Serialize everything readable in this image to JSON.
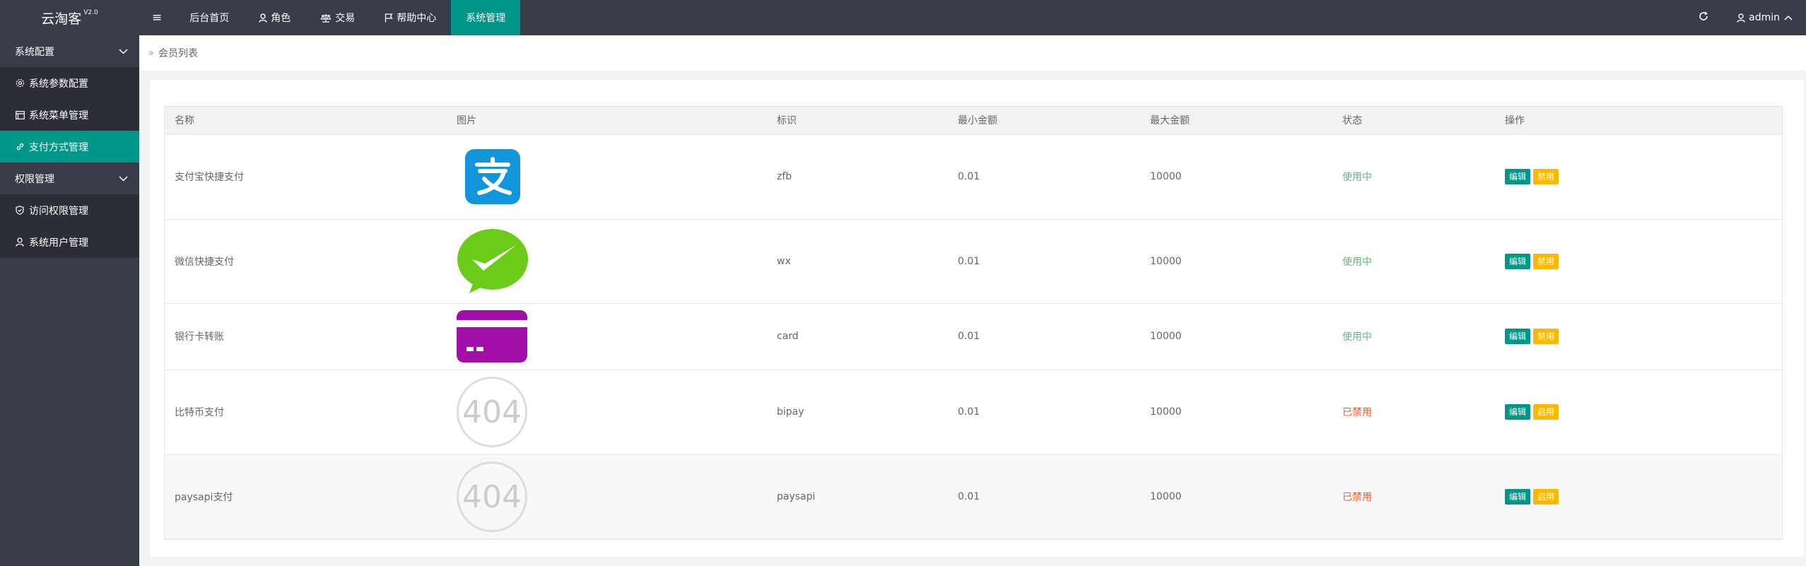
{
  "app": {
    "title": "云淘客",
    "version": "V2.0"
  },
  "nav": {
    "toggle_icon": "menu-icon",
    "items": [
      {
        "label": "后台首页",
        "icon": ""
      },
      {
        "label": "角色",
        "icon": "user-icon"
      },
      {
        "label": "交易",
        "icon": "scale-icon"
      },
      {
        "label": "帮助中心",
        "icon": "flag-icon"
      },
      {
        "label": "系统管理",
        "icon": "",
        "active": true
      }
    ]
  },
  "header_right": {
    "refresh_icon": "refresh-icon",
    "user": "admin"
  },
  "sidebar": {
    "groups": [
      {
        "label": "系统配置",
        "items": [
          {
            "label": "系统参数配置",
            "icon": "gear-icon"
          },
          {
            "label": "系统菜单管理",
            "icon": "list-icon"
          },
          {
            "label": "支付方式管理",
            "icon": "link-icon",
            "active": true
          }
        ]
      },
      {
        "label": "权限管理",
        "items": [
          {
            "label": "访问权限管理",
            "icon": "shield-icon"
          },
          {
            "label": "系统用户管理",
            "icon": "user-icon"
          }
        ]
      }
    ]
  },
  "breadcrumb": {
    "label": "会员列表"
  },
  "table": {
    "headers": [
      "名称",
      "图片",
      "标识",
      "最小金额",
      "最大金额",
      "状态",
      "操作"
    ],
    "rows": [
      {
        "name": "支付宝快捷支付",
        "image": "alipay-logo",
        "code": "zfb",
        "min": "0.01",
        "max": "10000",
        "status": "使用中",
        "edit": "编辑",
        "toggle": "禁用"
      },
      {
        "name": "微信快捷支付",
        "image": "wechat-logo",
        "code": "wx",
        "min": "0.01",
        "max": "10000",
        "status": "使用中",
        "edit": "编辑",
        "toggle": "禁用"
      },
      {
        "name": "银行卡转账",
        "image": "bank-card-logo",
        "code": "card",
        "min": "0.01",
        "max": "10000",
        "status": "使用中",
        "edit": "编辑",
        "toggle": "禁用"
      },
      {
        "name": "比特币支付",
        "image": "404-placeholder",
        "image_text": "404",
        "code": "bipay",
        "min": "0.01",
        "max": "10000",
        "status": "已禁用",
        "edit": "编辑",
        "toggle": "启用"
      },
      {
        "name": "paysapi支付",
        "image": "404-placeholder",
        "image_text": "404",
        "code": "paysapi",
        "min": "0.01",
        "max": "10000",
        "status": "已禁用",
        "edit": "编辑",
        "toggle": "启用"
      }
    ]
  },
  "colors": {
    "header": "#393d49",
    "accent": "#009688",
    "warn": "#ffb800",
    "status_on": "#5fb878",
    "status_off": "#ff5722"
  }
}
